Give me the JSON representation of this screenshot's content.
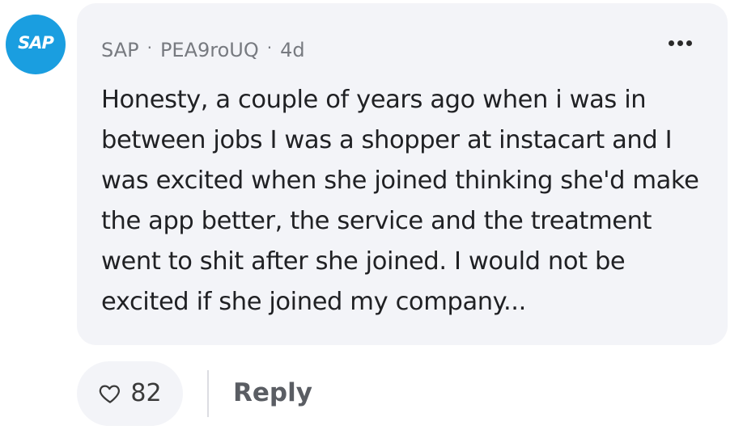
{
  "comment": {
    "avatar_text": "SAP",
    "author": "SAP",
    "username": "PEA9roUQ",
    "timestamp": "4d",
    "separator": "·",
    "body": "Honesty, a couple of years ago when i was in between jobs I was a shopper at instacart and I was excited when she joined thinking she'd make the app better, the service and the treatment went to shit after she joined. I would not be excited if she joined my company...",
    "like_count": "82",
    "reply_label": "Reply",
    "more_icon": "ellipsis-icon",
    "like_icon": "heart-outline-icon"
  },
  "colors": {
    "avatar_bg": "#1a9ee0",
    "bubble_bg": "#f3f4f8",
    "meta_text": "#777a80"
  }
}
